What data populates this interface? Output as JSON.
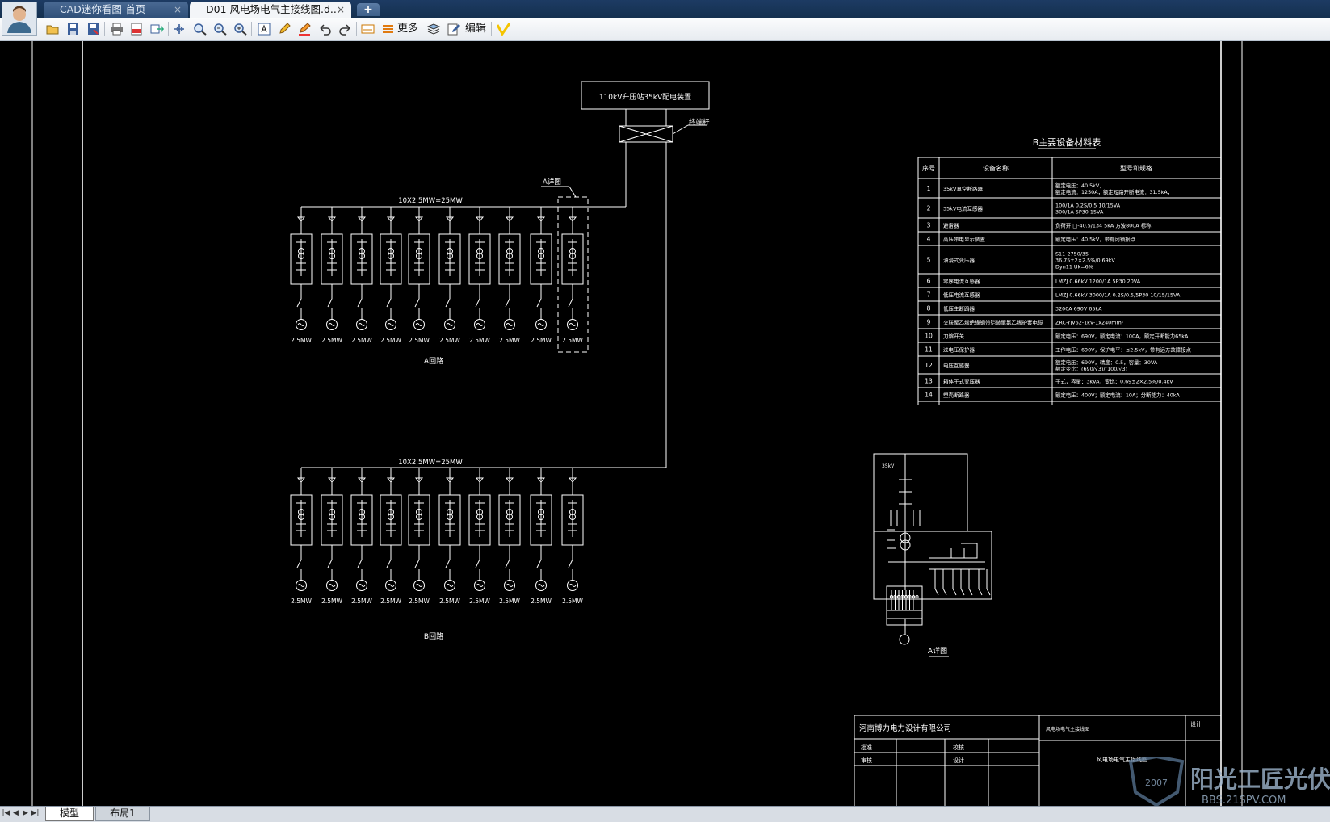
{
  "app": {
    "tabs": [
      {
        "label": "CAD迷你看图-首页",
        "close": "×"
      },
      {
        "label": "D01 风电场电气主接线图.d...",
        "close": "×"
      }
    ],
    "new_tab": "+"
  },
  "toolbar": {
    "more_label": "更多",
    "edit_label": "编辑"
  },
  "drawing": {
    "substation_box": "110kV升压站35kV配电装置",
    "cable_label": "终端杆",
    "detail_a_ref": "A详图",
    "bus_a_label": "10X2.5MW=25MW",
    "bus_b_label": "10X2.5MW=25MW",
    "turbine_rating": "2.5MW",
    "circuit_a_title": "A回路",
    "circuit_b_title": "B回路",
    "detail_a_title": "A详图",
    "detail_bus_label": "35kV",
    "table": {
      "title": "B主要设备材料表",
      "headers": [
        "序号",
        "设备名称",
        "型号和规格"
      ],
      "rows": [
        {
          "no": "1",
          "name": "35kV真空断路器",
          "spec": [
            "额定电压：40.5kV，",
            "额定电流：1250A；额定短路开断电流：31.5kA，"
          ]
        },
        {
          "no": "2",
          "name": "35kV电流互感器",
          "spec": [
            "100/1A 0.2S/0.5  10/15VA",
            "300/1A 5P30 15VA"
          ]
        },
        {
          "no": "3",
          "name": "避雷器",
          "spec": [
            "负荷开 □-40.5/134 5kA 方波800A 标称"
          ]
        },
        {
          "no": "4",
          "name": "高压带电显示装置",
          "spec": [
            "额定电压：40.5kV，带有闭锁接点"
          ]
        },
        {
          "no": "5",
          "name": "油浸式变压器",
          "spec": [
            "S11-2750/35",
            "36.75±2×2.5%/0.69kV",
            "Dyn11  Uk=6%"
          ]
        },
        {
          "no": "6",
          "name": "零序电流互感器",
          "spec": [
            "LMZJ 0.66kV  1200/1A  5P30  20VA"
          ]
        },
        {
          "no": "7",
          "name": "低压电流互感器",
          "spec": [
            "LMZJ 0.66kV 3000/1A  0.2S/0.5/5P30 10/15/15VA"
          ]
        },
        {
          "no": "8",
          "name": "低压主断路器",
          "spec": [
            "3200A  690V  65kA"
          ]
        },
        {
          "no": "9",
          "name": "交联聚乙烯绝缘钢带铠装聚氯乙烯护套电缆",
          "spec": [
            "ZRC-YJV62-1kV-1x240mm²"
          ]
        },
        {
          "no": "10",
          "name": "刀熔开关",
          "spec": [
            "额定电压：690V，额定电流：100A，额定开断能力65kA"
          ]
        },
        {
          "no": "11",
          "name": "过电压保护器",
          "spec": [
            "工作电压：690V，保护电平：≤2.5kV，带有远方故障接点"
          ]
        },
        {
          "no": "12",
          "name": "电压互感器",
          "spec": [
            "额定电压：690V，精度：0.5，容量：30VA",
            "额定变比：(690/√3)/(100/√3)"
          ]
        },
        {
          "no": "13",
          "name": "箱体干式变压器",
          "spec": [
            "干式，容量：3kVA，变比：0.69±2×2.5%/0.4kV"
          ]
        },
        {
          "no": "14",
          "name": "塑壳断路器",
          "spec": [
            "额定电压：400V；额定电流：10A；分断能力：40kA"
          ]
        }
      ]
    },
    "title_block": {
      "company": "河南博力电力设计有限公司",
      "project": "风电场电气主接线图",
      "drawing_name": "风电场电气主接线图",
      "rows": [
        [
          "批准",
          "",
          "校核",
          ""
        ],
        [
          "审核",
          "",
          "设计",
          ""
        ]
      ],
      "stage_label": "设计"
    }
  },
  "layout_tabs": [
    "模型",
    "布局1"
  ],
  "watermark": {
    "text": "阳光工匠光伏论坛",
    "url": "BBS.21SPV.COM",
    "year": "2007"
  },
  "colors": {
    "canvas": "#000000",
    "lines": "#ffffff",
    "accent": "#f5c400"
  }
}
